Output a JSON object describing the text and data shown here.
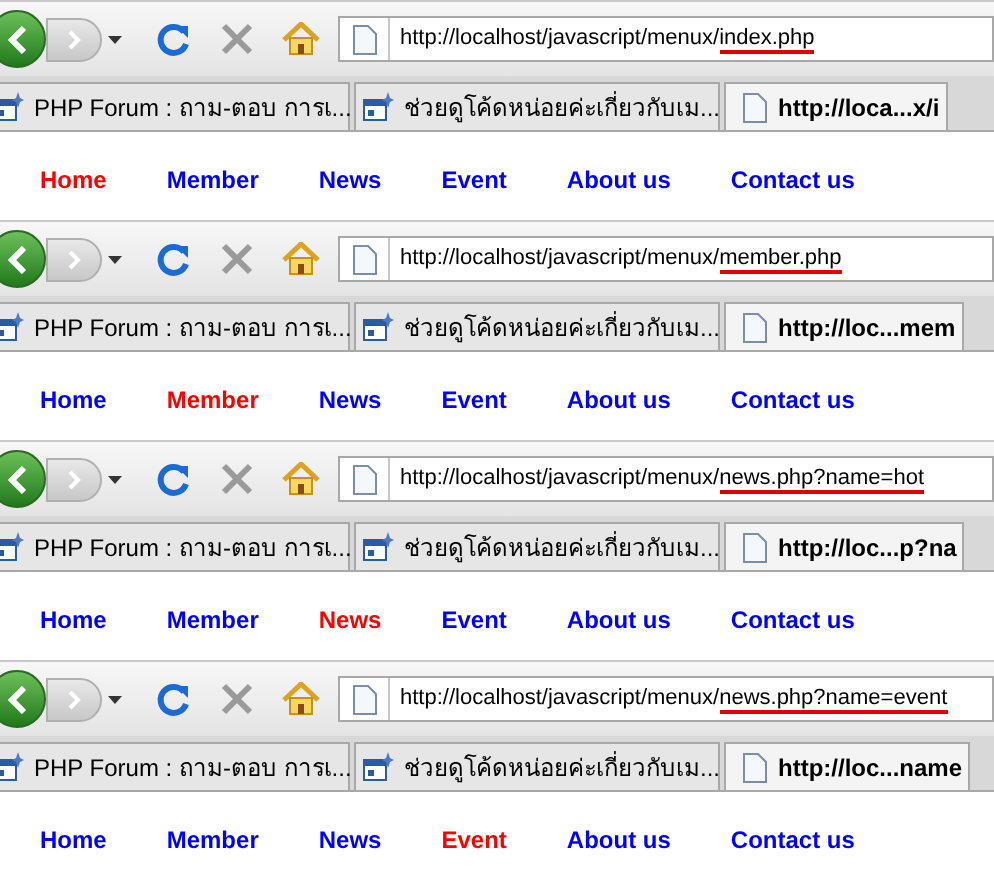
{
  "panels": [
    {
      "url_base": "http://localhost/javascript/menux/",
      "url_page": "index.php",
      "tabs": [
        {
          "title": "PHP Forum : ถาม-ตอบ การเ...",
          "selected": false
        },
        {
          "title": "ช่วยดูโค้ดหน่อยค่ะเกี่ยวกับเม...",
          "selected": false
        },
        {
          "title": "http://loca...x/i",
          "selected": true
        }
      ],
      "menu": [
        {
          "label": "Home",
          "selected": true
        },
        {
          "label": "Member",
          "selected": false
        },
        {
          "label": "News",
          "selected": false
        },
        {
          "label": "Event",
          "selected": false
        },
        {
          "label": "About us",
          "selected": false
        },
        {
          "label": "Contact us",
          "selected": false
        }
      ]
    },
    {
      "url_base": "http://localhost/javascript/menux/",
      "url_page": "member.php",
      "tabs": [
        {
          "title": "PHP Forum : ถาม-ตอบ การเ...",
          "selected": false
        },
        {
          "title": "ช่วยดูโค้ดหน่อยค่ะเกี่ยวกับเม...",
          "selected": false
        },
        {
          "title": "http://loc...mem",
          "selected": true
        }
      ],
      "menu": [
        {
          "label": "Home",
          "selected": false
        },
        {
          "label": "Member",
          "selected": true
        },
        {
          "label": "News",
          "selected": false
        },
        {
          "label": "Event",
          "selected": false
        },
        {
          "label": "About us",
          "selected": false
        },
        {
          "label": "Contact us",
          "selected": false
        }
      ]
    },
    {
      "url_base": "http://localhost/javascript/menux/",
      "url_page": "news.php?name=hot",
      "tabs": [
        {
          "title": "PHP Forum : ถาม-ตอบ การเ...",
          "selected": false
        },
        {
          "title": "ช่วยดูโค้ดหน่อยค่ะเกี่ยวกับเม...",
          "selected": false
        },
        {
          "title": "http://loc...p?na",
          "selected": true
        }
      ],
      "menu": [
        {
          "label": "Home",
          "selected": false
        },
        {
          "label": "Member",
          "selected": false
        },
        {
          "label": "News",
          "selected": true
        },
        {
          "label": "Event",
          "selected": false
        },
        {
          "label": "About us",
          "selected": false
        },
        {
          "label": "Contact us",
          "selected": false
        }
      ]
    },
    {
      "url_base": "http://localhost/javascript/menux/",
      "url_page": "news.php?name=event",
      "tabs": [
        {
          "title": "PHP Forum : ถาม-ตอบ การเ...",
          "selected": false
        },
        {
          "title": "ช่วยดูโค้ดหน่อยค่ะเกี่ยวกับเม...",
          "selected": false
        },
        {
          "title": "http://loc...name",
          "selected": true
        }
      ],
      "menu": [
        {
          "label": "Home",
          "selected": false
        },
        {
          "label": "Member",
          "selected": false
        },
        {
          "label": "News",
          "selected": false
        },
        {
          "label": "Event",
          "selected": true
        },
        {
          "label": "About us",
          "selected": false
        },
        {
          "label": "Contact us",
          "selected": false
        }
      ]
    }
  ]
}
